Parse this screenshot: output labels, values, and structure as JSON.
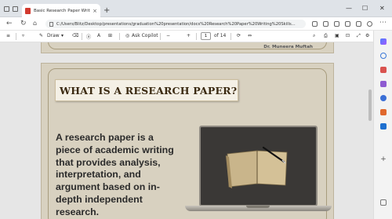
{
  "browser": {
    "tab_title": "Basic Research Paper Writing Wo...",
    "tab_close": "×",
    "new_tab": "+",
    "window_controls": {
      "minimize": "—",
      "maximize": "☐",
      "close": "✕"
    },
    "url": "C:/Users/Blitz/Desktop/presentations/graduation%20presentation/docs%20Research%20Paper%20Writing%20Skills...",
    "back": "←",
    "refresh": "↻"
  },
  "pdf_toolbar": {
    "menu_icon": "≡",
    "draw_label": "Draw",
    "read_aloud_label": "A",
    "ask_copilot_label": "Ask Copilot",
    "zoom_out": "−",
    "zoom_in": "+",
    "page_current": "1",
    "page_total": "of 14"
  },
  "document": {
    "author": "Dr. Muneera Muftah",
    "heading": "What is a Research Paper?",
    "body": "A research paper is a piece of academic writing that provides analysis, interpretation, and argument based on in-depth independent research."
  },
  "sidebar": {
    "icons": [
      "copilot-icon",
      "search-icon",
      "shopping-icon",
      "tools-icon",
      "games-icon",
      "office-icon",
      "outlook-icon",
      "add-icon"
    ]
  }
}
